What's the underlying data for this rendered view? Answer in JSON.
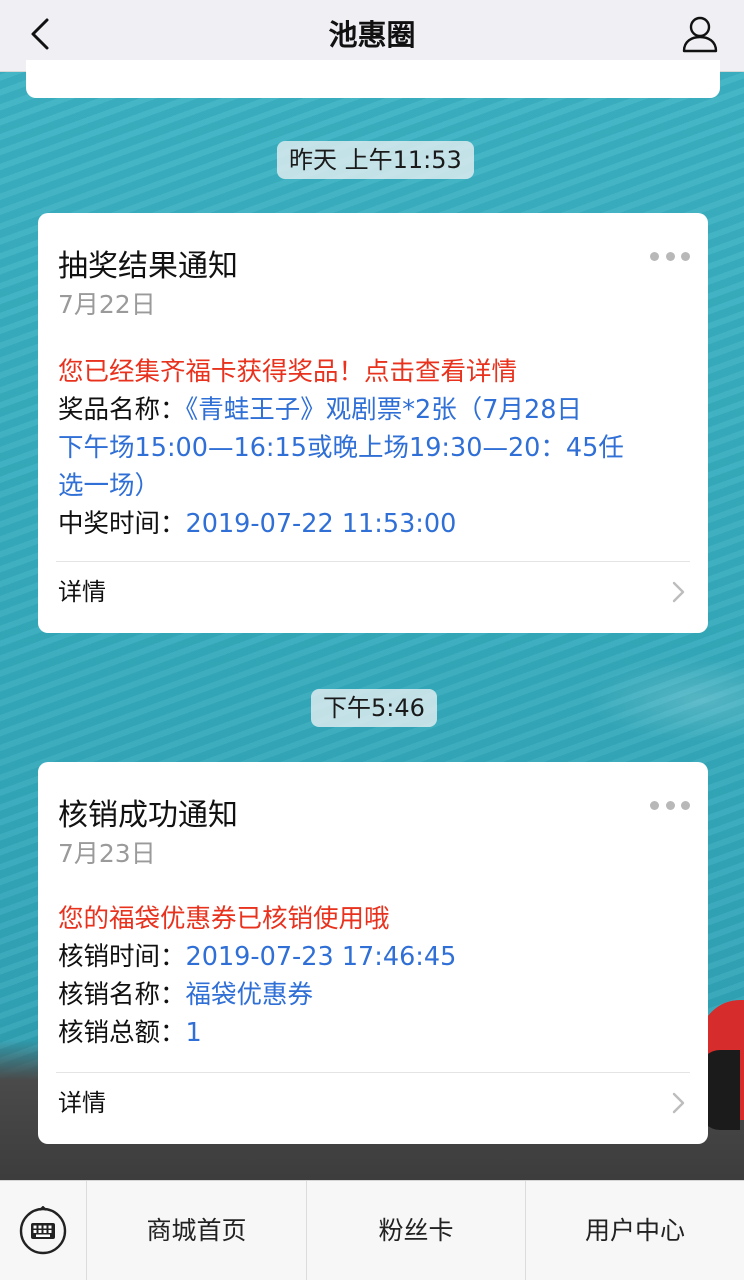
{
  "header": {
    "title": "池惠圈"
  },
  "messages": [
    {
      "time": "昨天 上午11:53",
      "title": "抽奖结果通知",
      "date": "7月22日",
      "highlight": "您已经集齐福卡获得奖品！点击查看详情",
      "fields": [
        {
          "label": "奖品名称：",
          "value": "《青蛙王子》观剧票*2张（7月28日"
        },
        {
          "label": "",
          "value": "下午场15:00—16:15或晚上场19:30—20：45任"
        },
        {
          "label": "",
          "value": "选一场）"
        },
        {
          "label": "中奖时间：",
          "value": "2019-07-22 11:53:00"
        }
      ],
      "detail_label": "详情"
    },
    {
      "time": "下午5:46",
      "title": "核销成功通知",
      "date": "7月23日",
      "highlight": "您的福袋优惠券已核销使用哦",
      "fields": [
        {
          "label": "核销时间：",
          "value": "2019-07-23 17:46:45"
        },
        {
          "label": "核销名称：",
          "value": "福袋优惠券"
        },
        {
          "label": "核销总额：",
          "value": "1"
        }
      ],
      "detail_label": "详情"
    }
  ],
  "bottom_nav": {
    "items": [
      {
        "label": "商城首页"
      },
      {
        "label": "粉丝卡"
      },
      {
        "label": "用户中心"
      }
    ]
  },
  "icons": {
    "back": "chevron-left-icon",
    "user": "user-icon",
    "more": "more-dots-icon",
    "chevron": "chevron-right-icon",
    "keyboard": "keyboard-icon"
  },
  "colors": {
    "highlight": "#e8321e",
    "value": "#2f6fd6",
    "header_bg": "#efeff4"
  }
}
